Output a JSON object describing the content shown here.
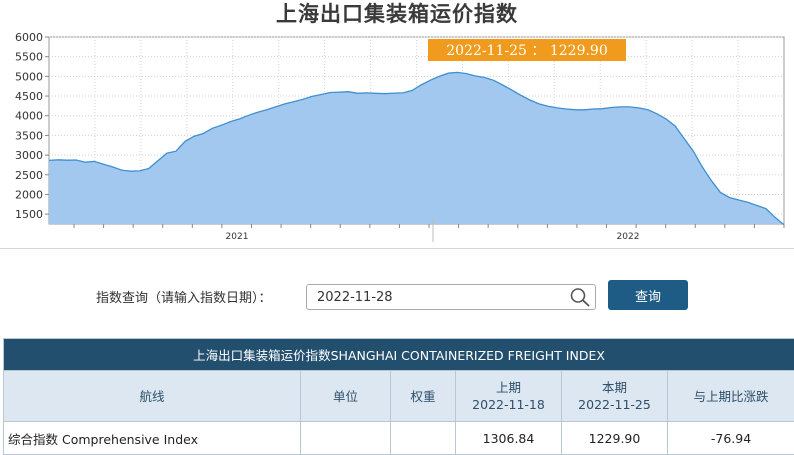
{
  "page_title": "上海出口集装箱运价指数",
  "chart_data": {
    "type": "area",
    "title": "上海出口集装箱运价指数",
    "y_ticks": [
      1500,
      2000,
      2500,
      3000,
      3500,
      4000,
      4500,
      5000,
      5500,
      6000
    ],
    "ylim": [
      1250,
      6000
    ],
    "x_ticks": [
      "2021",
      "2022"
    ],
    "grid": true,
    "fill_color": "#a2c8ef",
    "line_color": "#3f8fd0",
    "tooltip": {
      "date": "2022-11-25",
      "value": "1229.90",
      "text": "2022-11-25 ： 1229.90"
    },
    "series": [
      {
        "values": [
          2865,
          2880,
          2870,
          2875,
          2820,
          2840,
          2770,
          2700,
          2620,
          2590,
          2600,
          2660,
          2860,
          3050,
          3100,
          3350,
          3480,
          3550,
          3680,
          3760,
          3850,
          3920,
          4010,
          4090,
          4150,
          4230,
          4300,
          4360,
          4420,
          4490,
          4540,
          4590,
          4600,
          4610,
          4570,
          4580,
          4570,
          4560,
          4575,
          4580,
          4640,
          4780,
          4900,
          5000,
          5080,
          5100,
          5070,
          5010,
          4970,
          4900,
          4780,
          4650,
          4520,
          4400,
          4300,
          4240,
          4200,
          4170,
          4150,
          4150,
          4170,
          4180,
          4210,
          4225,
          4225,
          4200,
          4150,
          4050,
          3920,
          3740,
          3420,
          3100,
          2700,
          2350,
          2050,
          1920,
          1860,
          1800,
          1720,
          1640,
          1420,
          1229.9
        ]
      }
    ]
  },
  "query": {
    "label": "指数查询（请输入指数日期）：",
    "value": "2022-11-28",
    "button": "查询"
  },
  "table": {
    "caption": "上海出口集装箱运价指数SHANGHAI CONTAINERIZED FREIGHT INDEX",
    "headers": {
      "route": "航线",
      "unit": "单位",
      "weight": "权重",
      "prev_label": "上期",
      "prev_date": "2022-11-18",
      "curr_label": "本期",
      "curr_date": "2022-11-25",
      "change": "与上期比涨跌"
    },
    "rows": [
      {
        "route": "综合指数 Comprehensive Index",
        "unit": "",
        "weight": "",
        "prev": "1306.84",
        "curr": "1229.90",
        "change": "-76.94"
      }
    ]
  }
}
